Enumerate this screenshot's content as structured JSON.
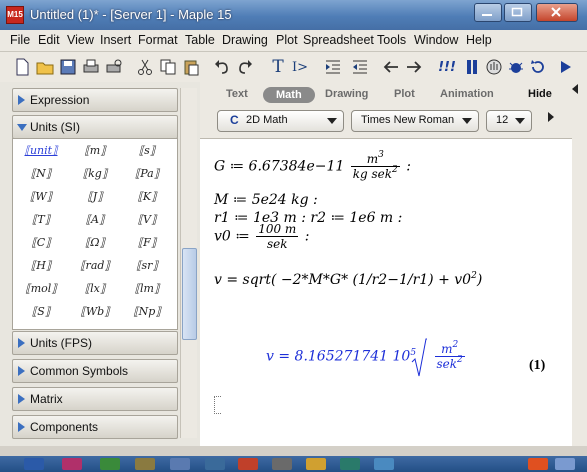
{
  "window": {
    "title": "Untitled (1)* - [Server 1] - Maple 15",
    "icon_text": "M15"
  },
  "menubar": [
    "File",
    "Edit",
    "View",
    "Insert",
    "Format",
    "Table",
    "Drawing",
    "Plot",
    "Spreadsheet",
    "Tools",
    "Window",
    "Help"
  ],
  "toolbar": {
    "text_button": "T",
    "math_button": "I>",
    "exec_button": "!!!",
    "icons": [
      "new-doc-icon",
      "open-folder-icon",
      "save-icon",
      "print-icon",
      "print-preview-icon",
      "cut-icon",
      "copy-icon",
      "paste-icon",
      "undo-icon",
      "redo-icon",
      "text-mode-icon",
      "math-mode-icon",
      "indent-icon",
      "outdent-icon",
      "back-icon",
      "forward-icon",
      "execute-all-icon",
      "stop-icon",
      "restart-icon",
      "hand-icon",
      "debug-icon",
      "help-icon"
    ]
  },
  "palettes": {
    "expression": "Expression",
    "units_si": "Units (SI)",
    "units_fps": "Units (FPS)",
    "common_symbols": "Common Symbols",
    "matrix": "Matrix",
    "components": "Components",
    "unit_symbols": [
      "⟦unit⟧",
      "⟦m⟧",
      "⟦s⟧",
      "⟦N⟧",
      "⟦kg⟧",
      "⟦Pa⟧",
      "⟦W⟧",
      "⟦J⟧",
      "⟦K⟧",
      "⟦T⟧",
      "⟦A⟧",
      "⟦V⟧",
      "⟦C⟧",
      "⟦Ω⟧",
      "⟦F⟧",
      "⟦H⟧",
      "⟦rad⟧",
      "⟦sr⟧",
      "⟦mol⟧",
      "⟦lx⟧",
      "⟦lm⟧",
      "⟦S⟧",
      "⟦Wb⟧",
      "⟦Np⟧"
    ]
  },
  "context_bar": {
    "tabs": [
      "Text",
      "Math",
      "Drawing",
      "Plot",
      "Animation"
    ],
    "active_tab": "Math",
    "hide_label": "Hide",
    "mode_combo": "2D Math",
    "mode_prefix": "C",
    "font_combo": "Times New Roman",
    "size_combo": "12"
  },
  "worksheet": {
    "line1_lhs": "G ≔ 6.67384e−11",
    "line1_num": "m",
    "line1_num_exp": "3",
    "line1_den": "kg sek",
    "line1_den_exp": "2",
    "line1_end": ":",
    "line2": "M ≔ 5e24 kg :",
    "line3": "r1 ≔ 1e3 m : r2 ≔ 1e6 m :",
    "line4_lhs": "v0 ≔",
    "line4_num": "100 m",
    "line4_den": "sek",
    "line4_end": ":",
    "line5": "v = sqrt( −2*M*G* (1/r2−1/r1) + v0",
    "line5_exp": "2",
    "line5_end": ")",
    "result_lhs": "v = 8.165271741 10",
    "result_exp": "5",
    "result_num": "m",
    "result_num_exp": "2",
    "result_den": "sek",
    "result_den_exp": "2",
    "result_label": "(1)"
  },
  "colors": {
    "titlebar": "#4f7db6",
    "result_blue": "#1d2fd8",
    "palette_arrow": "#3b6fc0"
  }
}
